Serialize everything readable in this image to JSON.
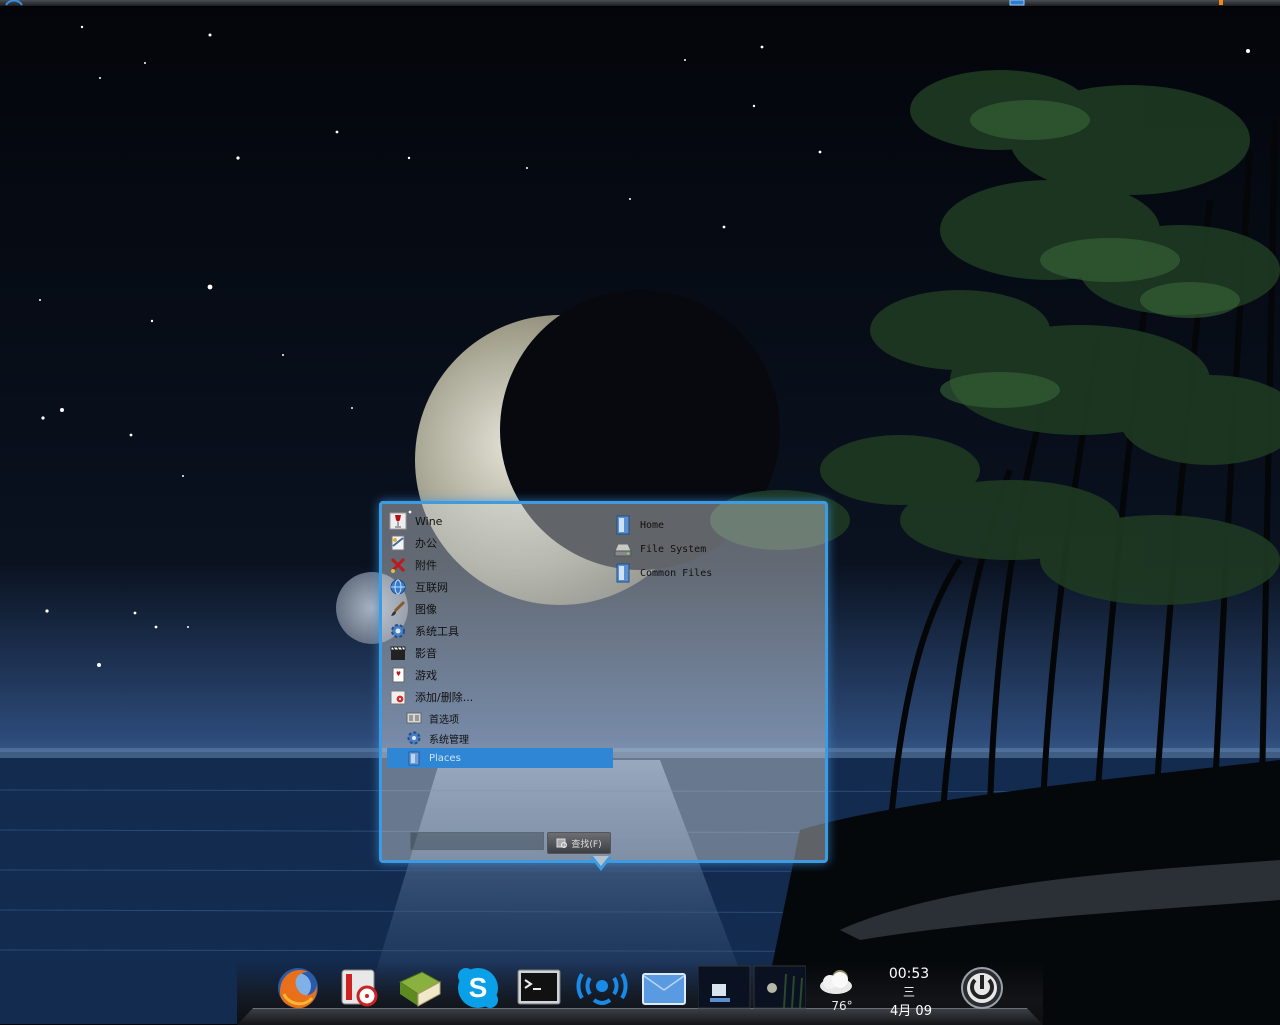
{
  "menu": {
    "categories": [
      {
        "label": "Wine",
        "icon": "wine-glass-icon"
      },
      {
        "label": "办公",
        "icon": "office-icon"
      },
      {
        "label": "附件",
        "icon": "accessories-icon"
      },
      {
        "label": "互联网",
        "icon": "internet-globe-icon"
      },
      {
        "label": "图像",
        "icon": "graphics-brush-icon"
      },
      {
        "label": "系统工具",
        "icon": "system-tools-gear-icon"
      },
      {
        "label": "影音",
        "icon": "multimedia-clapper-icon"
      },
      {
        "label": "游戏",
        "icon": "games-cards-icon"
      },
      {
        "label": "添加/删除...",
        "icon": "add-remove-software-icon"
      }
    ],
    "sub_items": [
      {
        "label": "首选项",
        "icon": "preferences-icon"
      },
      {
        "label": "系统管理",
        "icon": "administration-gear-icon"
      },
      {
        "label": "Places",
        "icon": "places-folder-icon",
        "selected": true
      }
    ],
    "places": [
      {
        "label": "Home",
        "icon": "home-folder-icon"
      },
      {
        "label": "File System",
        "icon": "drive-icon"
      },
      {
        "label": "Common Files",
        "icon": "common-files-folder-icon"
      }
    ],
    "search": {
      "value": "",
      "button_label": "查找(F)"
    }
  },
  "dock": {
    "items": [
      {
        "name": "firefox",
        "icon": "firefox-icon"
      },
      {
        "name": "media-player",
        "icon": "media-player-icon"
      },
      {
        "name": "dictionary",
        "icon": "book-icon"
      },
      {
        "name": "skype",
        "icon": "skype-icon"
      },
      {
        "name": "terminal",
        "icon": "terminal-icon"
      },
      {
        "name": "menu-launcher",
        "icon": "launcher-icon"
      },
      {
        "name": "mail",
        "icon": "mail-icon"
      },
      {
        "name": "desktop-switcher",
        "icon": "workspace-pager-icon"
      }
    ],
    "weather": {
      "temperature": "76°",
      "icon": "cloudy-weather-icon"
    },
    "clock": {
      "time": "00:53",
      "weekday": "三",
      "date": "4月 09"
    },
    "power": {
      "icon": "power-icon"
    }
  },
  "colors": {
    "menu_border": "#3f9be0",
    "selected_bg": "#2f86d4",
    "sky": "#05070d",
    "sea": "#1d3f6e"
  }
}
